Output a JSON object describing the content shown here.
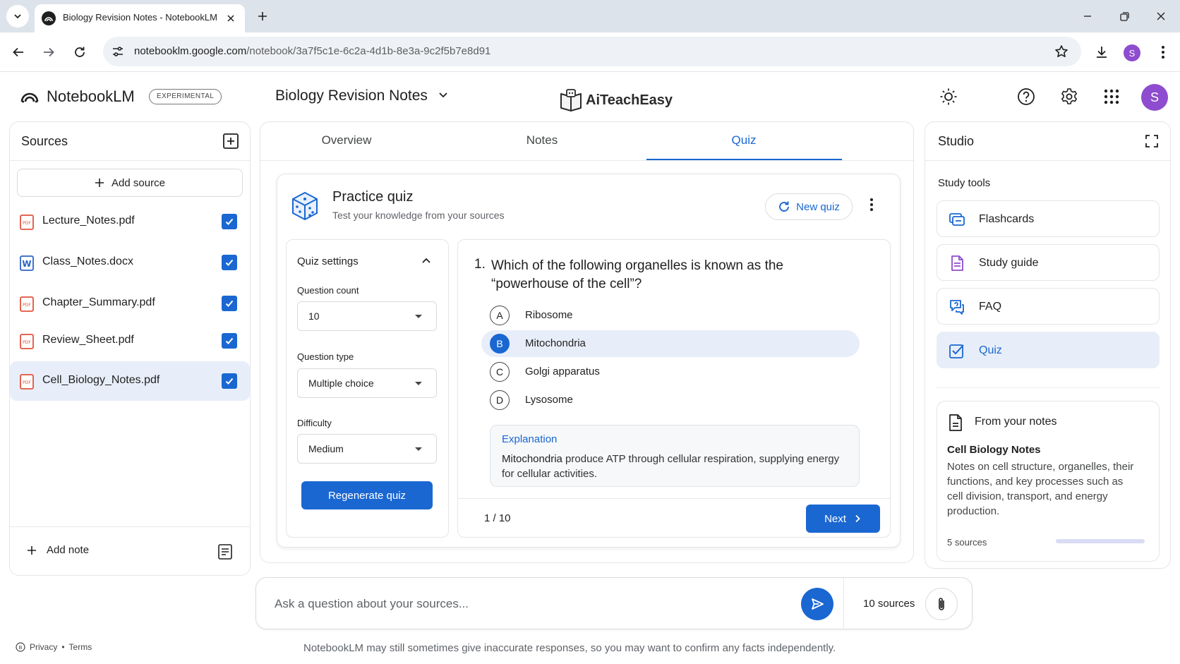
{
  "browser": {
    "tab_title": "Biology Revision Notes - NotebookLM",
    "url_host": "notebooklm.google.com",
    "url_path": "/notebook/3a7f5c1e-6c2a-4d1b-8e3a-9c2f5b7e8d91",
    "profile_initial": "S"
  },
  "header": {
    "app_name": "NotebookLM",
    "badge": "EXPERIMENTAL",
    "notebook_title": "Biology Revision Notes",
    "brand": "AiTeachEasy",
    "avatar_initial": "S"
  },
  "sources": {
    "title": "Sources",
    "add_label": "Add source",
    "items": [
      {
        "name": "Lecture_Notes.pdf",
        "type": "pdf",
        "checked": true
      },
      {
        "name": "Class_Notes.docx",
        "type": "docx",
        "checked": true
      },
      {
        "name": "Chapter_Summary.pdf",
        "type": "pdf",
        "checked": true
      },
      {
        "name": "Review_Sheet.pdf",
        "type": "pdf",
        "checked": true
      },
      {
        "name": "Cell_Biology_Notes.pdf",
        "type": "pdf",
        "checked": true,
        "selected": true
      }
    ],
    "add_note_label": "Add note"
  },
  "center": {
    "tabs": [
      {
        "label": "Overview"
      },
      {
        "label": "Notes"
      },
      {
        "label": "Quiz",
        "active": true
      }
    ],
    "quiz": {
      "title": "Practice quiz",
      "subtitle": "Test your knowledge from your sources",
      "new_quiz_label": "New quiz",
      "settings": {
        "title": "Quiz settings",
        "count_label": "Question count",
        "count_value": "10",
        "type_label": "Question type",
        "type_value": "Multiple choice",
        "difficulty_label": "Difficulty",
        "difficulty_value": "Medium",
        "regenerate_label": "Regenerate quiz"
      },
      "question": {
        "number": "1.",
        "text": "Which of the following organelles is known as the “powerhouse of the cell”?",
        "options": [
          {
            "letter": "A",
            "text": "Ribosome"
          },
          {
            "letter": "B",
            "text": "Mitochondria",
            "selected": true
          },
          {
            "letter": "C",
            "text": "Golgi apparatus"
          },
          {
            "letter": "D",
            "text": "Lysosome"
          }
        ],
        "explanation_title": "Explanation",
        "explanation_term": "Mitochondria",
        "explanation_rest": " produce ATP through cellular respiration, supplying energy for cellular activities."
      },
      "progress": "1 / 10",
      "next_label": "Next"
    }
  },
  "studio": {
    "title": "Studio",
    "subtitle": "Study tools",
    "tools": [
      {
        "label": "Flashcards",
        "icon": "flashcards-icon"
      },
      {
        "label": "Study guide",
        "icon": "study-guide-icon"
      },
      {
        "label": "FAQ",
        "icon": "faq-icon"
      },
      {
        "label": "Quiz",
        "icon": "quiz-icon",
        "selected": true
      }
    ],
    "note_card": {
      "heading": "From your notes",
      "title": "Cell Biology Notes",
      "body": "Notes on cell structure, organelles, their functions, and key processes such as cell division, transport, and energy production.",
      "count": "5 sources"
    }
  },
  "chat": {
    "placeholder": "Ask a question about your sources...",
    "sources_count": "10 sources"
  },
  "footer": {
    "privacy": "Privacy",
    "separator": "•",
    "terms": "Terms",
    "disclaimer": "NotebookLM may still sometimes give inaccurate responses, so you may want to confirm any facts independently."
  },
  "colors": {
    "accent": "#1a67d2",
    "selected_bg": "#e8eef9",
    "avatar": "#8e4ccf",
    "pdf_red": "#e0533d",
    "docx_blue": "#2b66c4"
  }
}
